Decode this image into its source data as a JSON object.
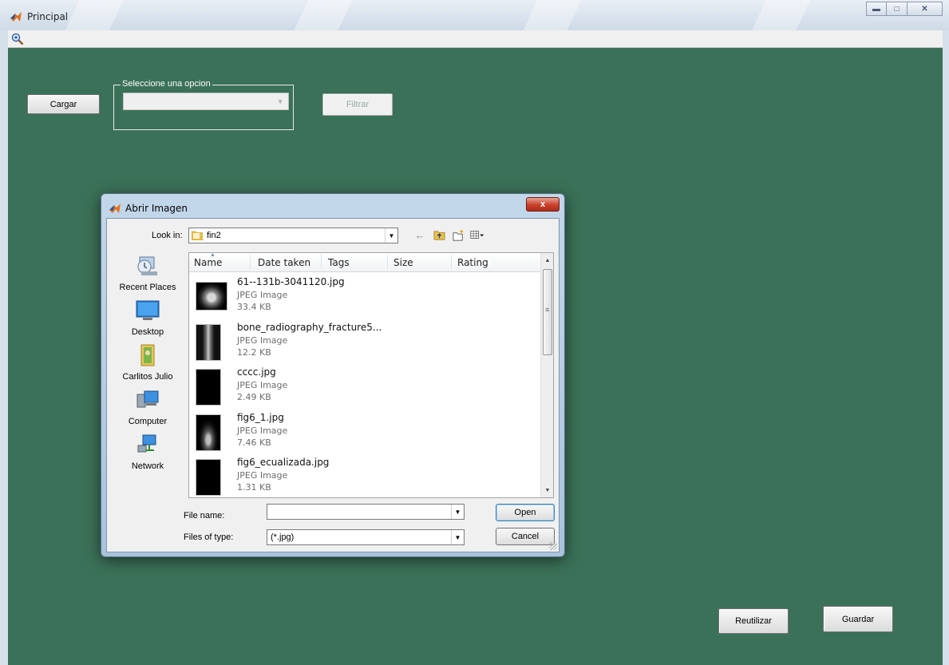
{
  "window": {
    "title": "Principal"
  },
  "toolbar": {
    "zoom_icon": "zoom-in-icon"
  },
  "main": {
    "cargar_label": "Cargar",
    "group_label": "Seleccione una opcion",
    "filter_select_value": "",
    "filtrar_label": "Filtrar",
    "reutilizar_label": "Reutilizar",
    "guardar_label": "Guardar"
  },
  "dialog": {
    "title": "Abrir Imagen",
    "close_label": "x",
    "look_in_label": "Look in:",
    "look_in_value": "fin2",
    "places": [
      "Recent Places",
      "Desktop",
      "Carlitos Julio",
      "Computer",
      "Network"
    ],
    "columns": [
      "Name",
      "Date taken",
      "Tags",
      "Size",
      "Rating"
    ],
    "files": [
      {
        "name": "61--131b-3041120.jpg",
        "type": "JPEG Image",
        "size": "33.4 KB"
      },
      {
        "name": "bone_radiography_fracture5...",
        "type": "JPEG Image",
        "size": "12.2 KB"
      },
      {
        "name": "cccc.jpg",
        "type": "JPEG Image",
        "size": "2.49 KB"
      },
      {
        "name": "fig6_1.jpg",
        "type": "JPEG Image",
        "size": "7.46 KB"
      },
      {
        "name": "fig6_ecualizada.jpg",
        "type": "JPEG Image",
        "size": "1.31 KB"
      }
    ],
    "file_name_label": "File name:",
    "file_name_value": "",
    "files_of_type_label": "Files of type:",
    "files_of_type_value": "(*.jpg)",
    "open_label": "Open",
    "cancel_label": "Cancel"
  }
}
